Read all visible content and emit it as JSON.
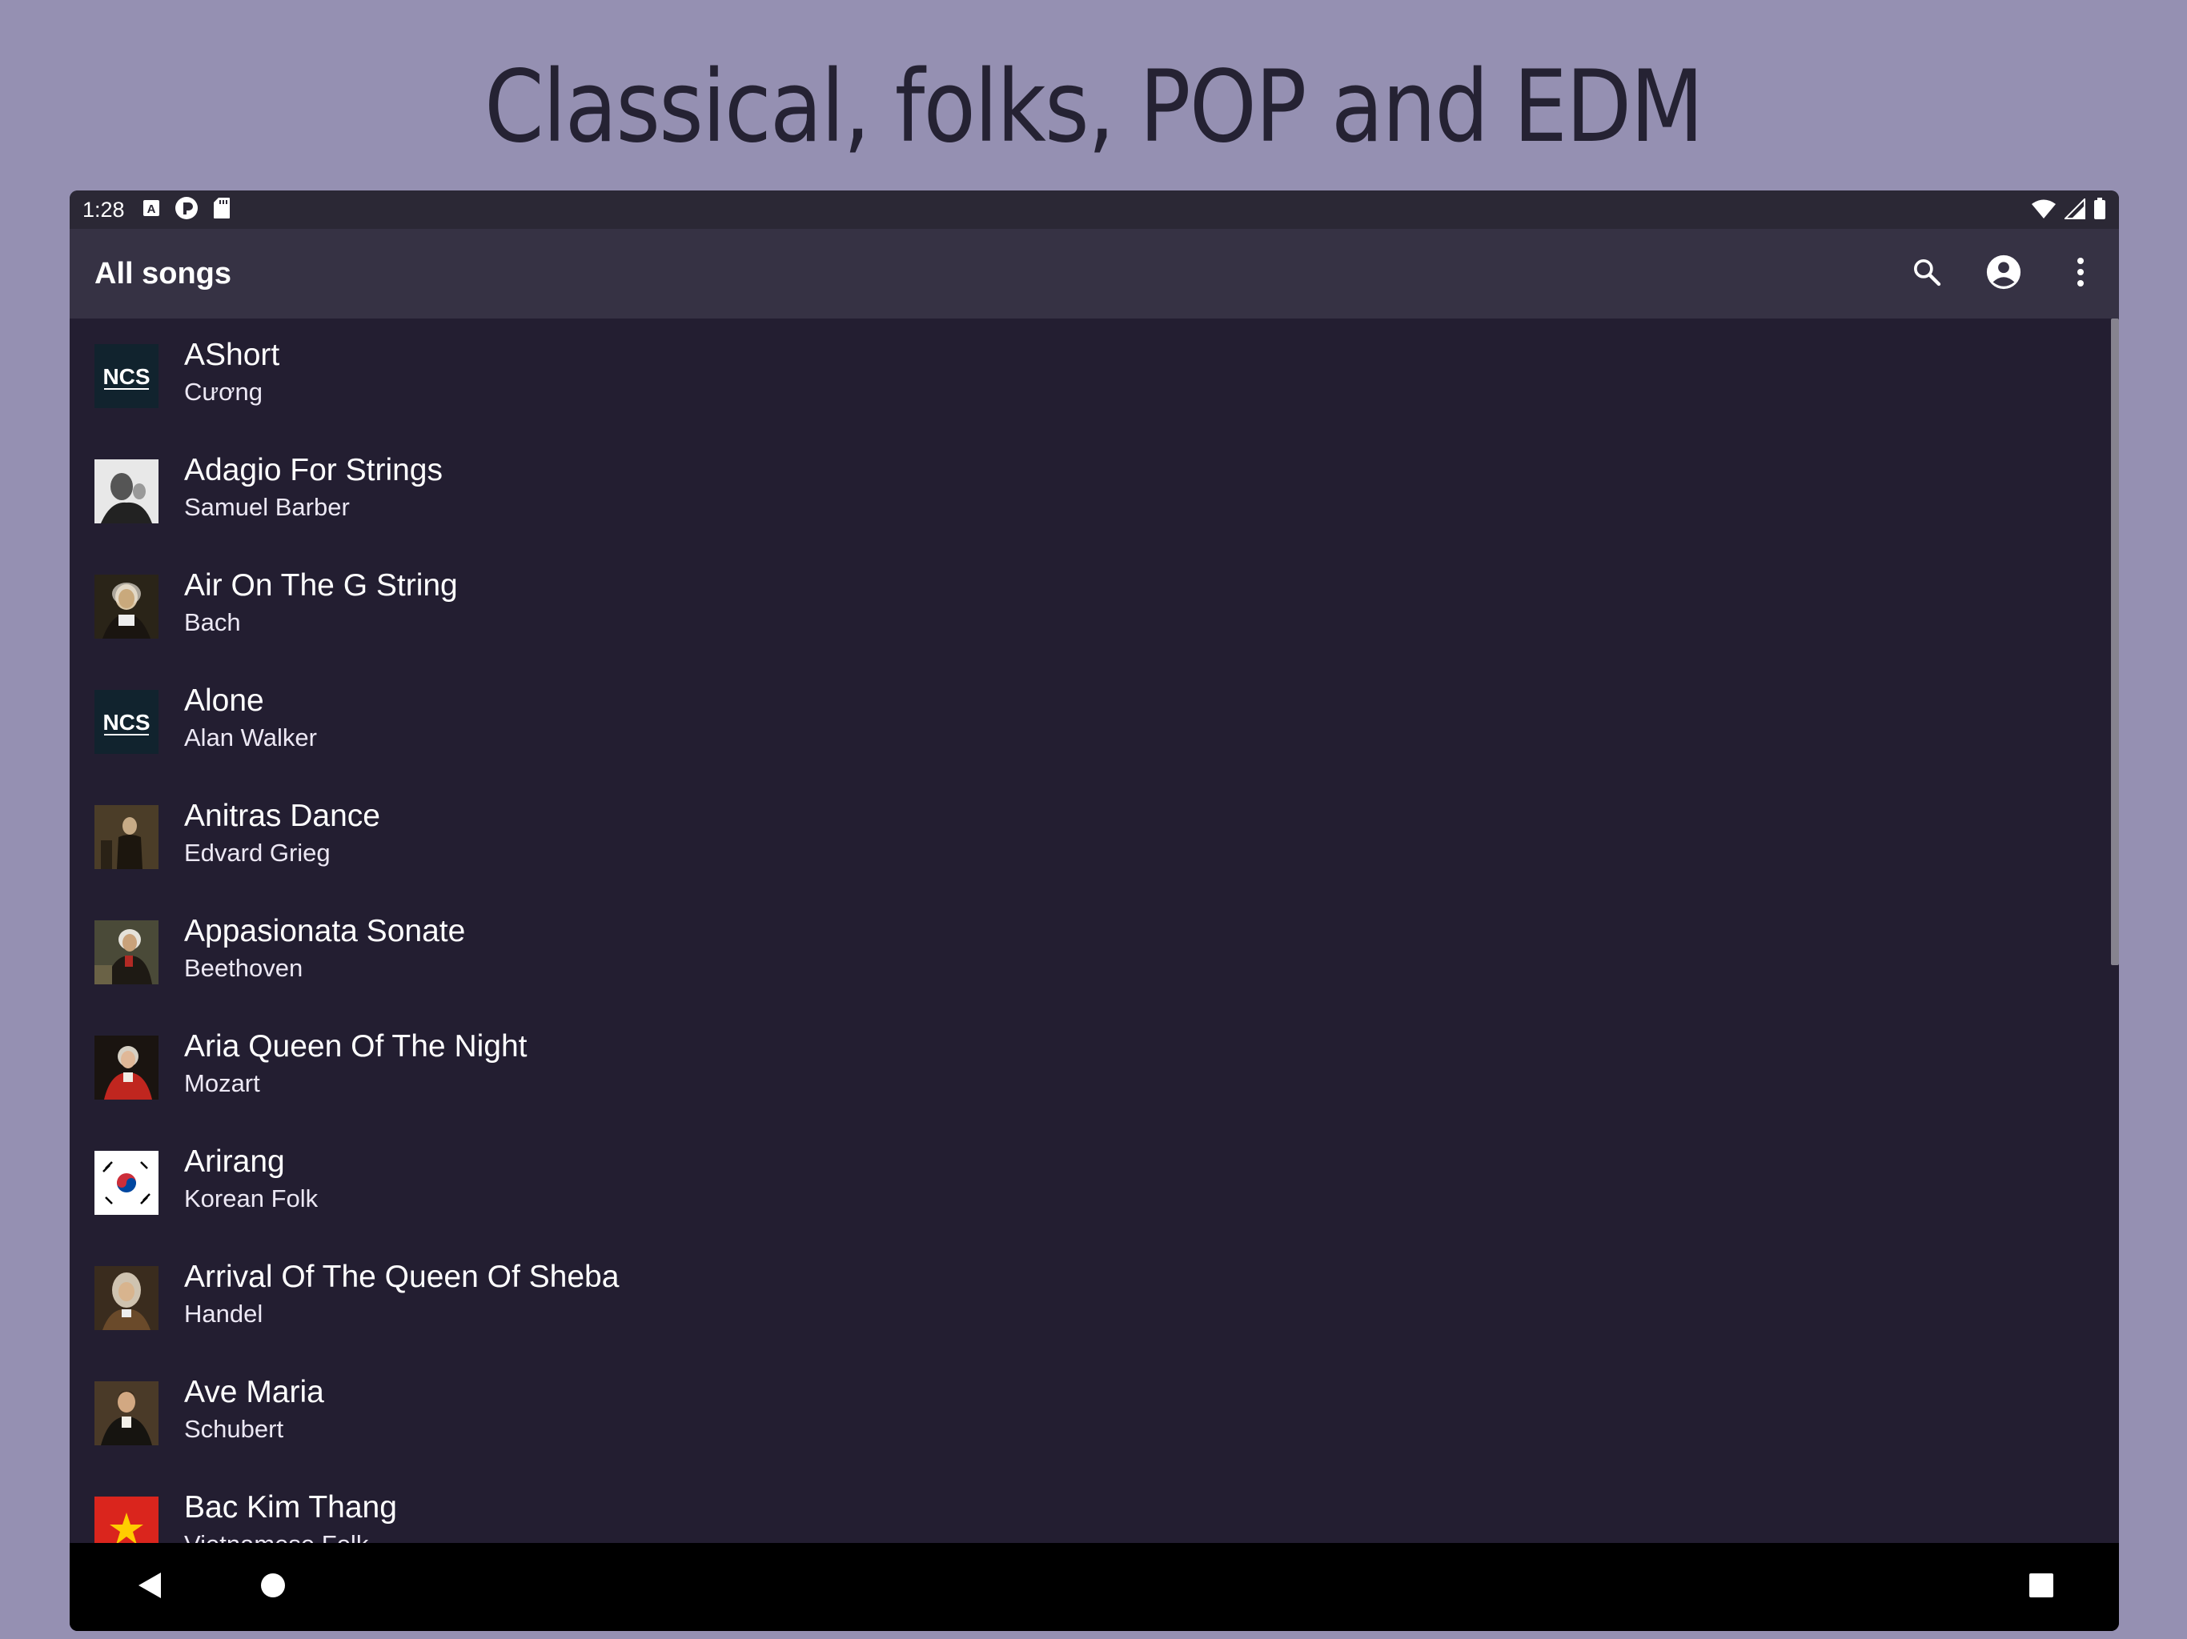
{
  "headline": "Classical, folks, POP and EDM",
  "status_bar": {
    "time": "1:28"
  },
  "app_bar": {
    "title": "All songs",
    "actions": [
      "search-icon",
      "account-circle-icon",
      "more-vert-icon"
    ]
  },
  "songs": [
    {
      "title": "AShort",
      "artist": "Cương",
      "art": "ncs-logo"
    },
    {
      "title": "Adagio For Strings",
      "artist": "Samuel Barber",
      "art": "portrait-bw"
    },
    {
      "title": "Air On The G String",
      "artist": "Bach",
      "art": "portrait"
    },
    {
      "title": "Alone",
      "artist": "Alan Walker",
      "art": "ncs-logo"
    },
    {
      "title": "Anitras Dance",
      "artist": "Edvard Grieg",
      "art": "portrait"
    },
    {
      "title": "Appasionata Sonate",
      "artist": "Beethoven",
      "art": "portrait"
    },
    {
      "title": "Aria Queen Of The Night",
      "artist": "Mozart",
      "art": "portrait-red"
    },
    {
      "title": "Arirang",
      "artist": "Korean Folk",
      "art": "korea-flag"
    },
    {
      "title": "Arrival Of The Queen Of Sheba",
      "artist": "Handel",
      "art": "portrait"
    },
    {
      "title": "Ave Maria",
      "artist": "Schubert",
      "art": "portrait"
    },
    {
      "title": "Bac Kim Thang",
      "artist": "Vietnamese Folk",
      "art": "vietnam-flag"
    }
  ],
  "colors": {
    "page_background": "#9590b2",
    "list_background": "#231e31",
    "app_bar": "#363244",
    "status_bar": "#2b2835"
  }
}
